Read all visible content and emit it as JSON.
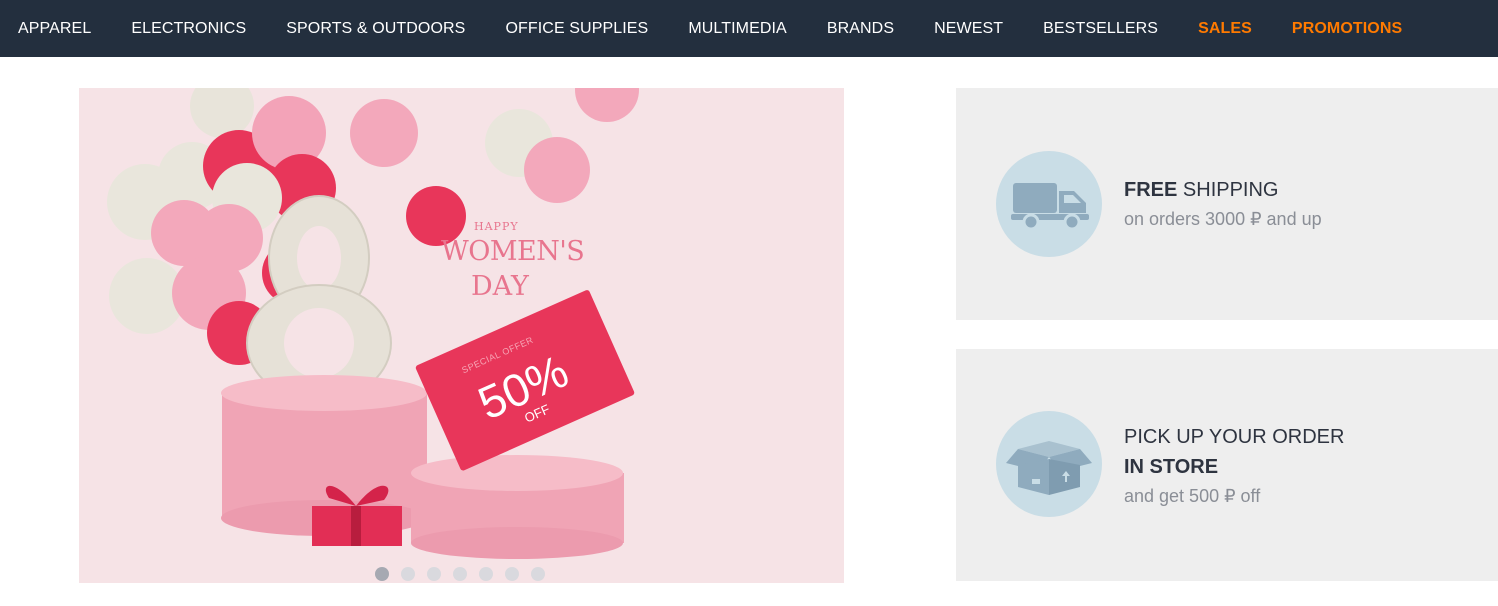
{
  "nav": {
    "items": [
      {
        "label": "APPAREL"
      },
      {
        "label": "ELECTRONICS"
      },
      {
        "label": "SPORTS & OUTDOORS"
      },
      {
        "label": "OFFICE SUPPLIES"
      },
      {
        "label": "MULTIMEDIA"
      },
      {
        "label": "BRANDS"
      },
      {
        "label": "NEWEST"
      },
      {
        "label": "BESTSELLERS"
      },
      {
        "label": "SALES"
      },
      {
        "label": "PROMOTIONS"
      }
    ],
    "highlight_color": "#ff7a00",
    "background": "#232f3e"
  },
  "banner": {
    "big_number": "8",
    "happy": "HAPPY",
    "womens": "WOMEN'S",
    "day": "DAY",
    "special_offer": "SPECIAL OFFER",
    "percent": "50%",
    "off": "OFF",
    "slide_count": 7,
    "active_slide": 1
  },
  "promos": {
    "shipping": {
      "bold": "FREE",
      "title": "SHIPPING",
      "subtitle": "on orders 3000 ₽ and up",
      "icon": "truck-icon"
    },
    "pickup": {
      "title": "PICK UP YOUR ORDER",
      "bold": "IN STORE",
      "subtitle": "and get 500 ₽ off",
      "icon": "box-icon"
    }
  }
}
